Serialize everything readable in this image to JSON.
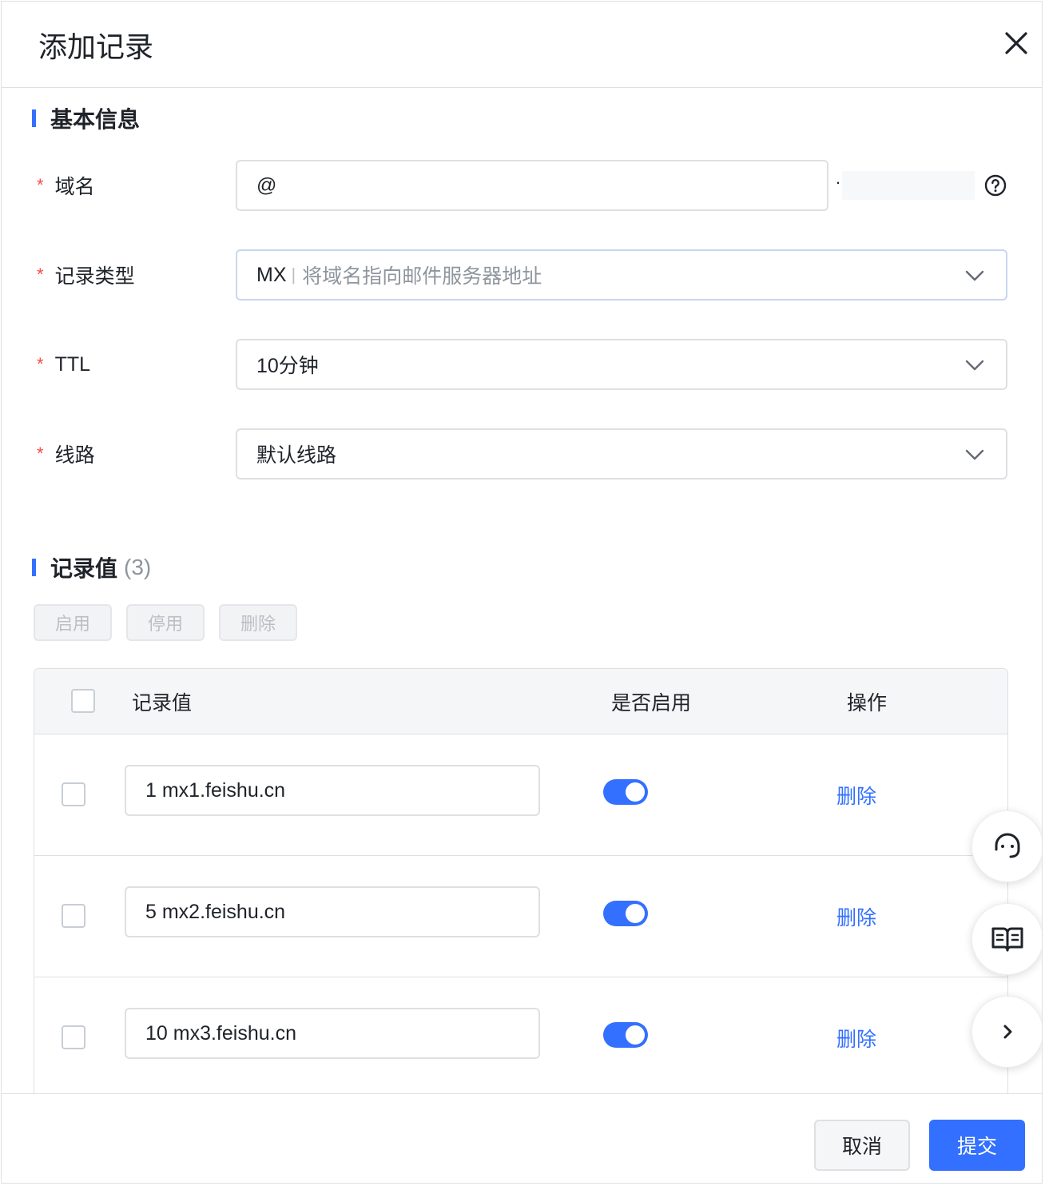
{
  "dialog": {
    "title": "添加记录",
    "close_icon": "close-icon"
  },
  "basic_info": {
    "section_title": "基本信息",
    "fields": {
      "domain": {
        "label": "域名",
        "value": "@",
        "suffix": ".",
        "help_icon": "question-circle-icon"
      },
      "record_type": {
        "label": "记录类型",
        "value": "MX",
        "hint": "将域名指向邮件服务器地址"
      },
      "ttl": {
        "label": "TTL",
        "value": "10分钟"
      },
      "line": {
        "label": "线路",
        "value": "默认线路"
      }
    },
    "required_mark": "*"
  },
  "records": {
    "section_title": "记录值",
    "count": "(3)",
    "batch_actions": {
      "enable": "启用",
      "disable": "停用",
      "delete": "删除"
    },
    "columns": {
      "value": "记录值",
      "enabled": "是否启用",
      "actions": "操作"
    },
    "rows": [
      {
        "value": "1 mx1.feishu.cn",
        "enabled": true,
        "action": "删除"
      },
      {
        "value": "5 mx2.feishu.cn",
        "enabled": true,
        "action": "删除"
      },
      {
        "value": "10 mx3.feishu.cn",
        "enabled": true,
        "action": "删除"
      }
    ]
  },
  "floating": {
    "support_icon": "headset-support-icon",
    "docs_icon": "open-book-icon",
    "collapse_icon": "chevron-right-icon"
  },
  "footer": {
    "cancel_label": "取消",
    "submit_label": "提交"
  },
  "colors": {
    "accent": "#3370ff",
    "required": "#f54a45",
    "border": "#dee0e3",
    "muted_text": "#8f959e"
  }
}
